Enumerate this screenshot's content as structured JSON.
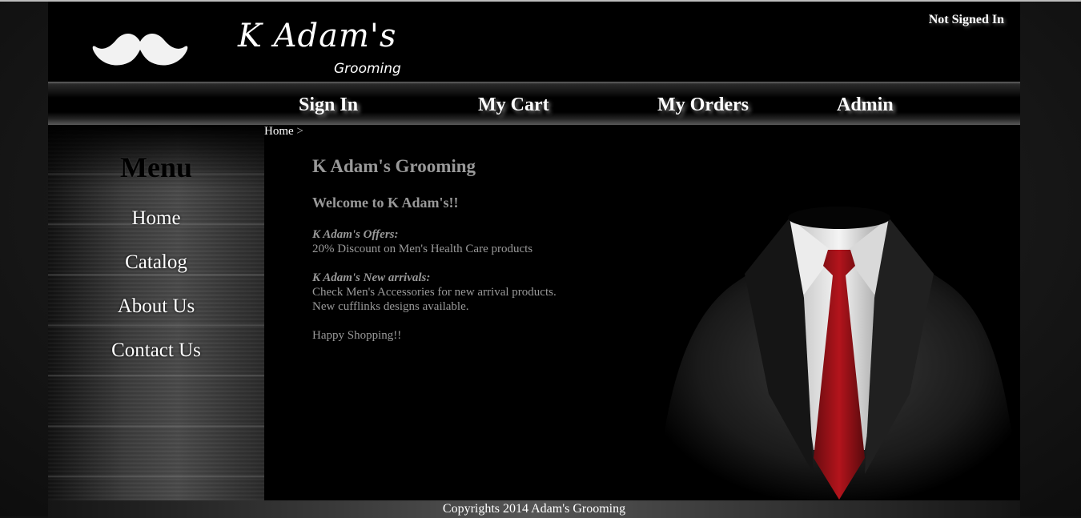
{
  "header": {
    "logo_title": "K Adam's",
    "logo_subtitle": "Grooming",
    "signin_status": "Not Signed In"
  },
  "nav": {
    "items": [
      {
        "label": "Sign In"
      },
      {
        "label": "My Cart"
      },
      {
        "label": "My Orders"
      },
      {
        "label": "Admin"
      }
    ]
  },
  "breadcrumb": {
    "home": "Home",
    "separator": ">"
  },
  "sidebar": {
    "title": "Menu",
    "items": [
      {
        "label": "Home"
      },
      {
        "label": "Catalog"
      },
      {
        "label": "About Us"
      },
      {
        "label": "Contact Us"
      }
    ]
  },
  "main": {
    "title": "K Adam's Grooming",
    "welcome": "Welcome to K Adam's!!",
    "offers_heading": "K Adam's Offers:",
    "offers_text": "20% Discount on Men's Health Care products",
    "arrivals_heading": "K Adam's New arrivals:",
    "arrivals_line1": "Check Men's Accessories for new arrival products.",
    "arrivals_line2": "New cufflinks designs available.",
    "closing": "Happy Shopping!!"
  },
  "footer": {
    "text": "Copyrights 2014 Adam's Grooming"
  }
}
